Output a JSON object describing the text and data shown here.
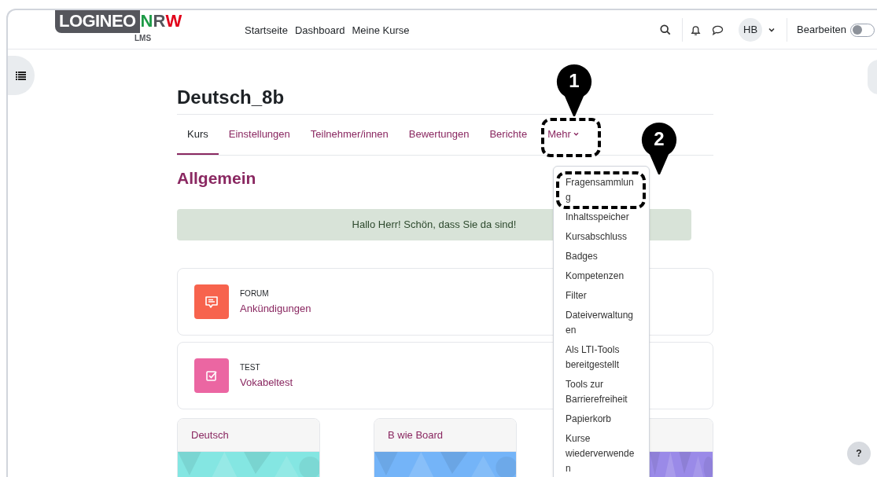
{
  "header": {
    "logo": {
      "word": "LOGINEO",
      "letters": [
        {
          "text": "N",
          "color": "#1d9a46"
        },
        {
          "text": "R",
          "color": "#55565c"
        },
        {
          "text": "W",
          "color": "#e1001a"
        }
      ],
      "subtitle": "LMS"
    },
    "nav": [
      "Startseite",
      "Dashboard",
      "Meine Kurse"
    ],
    "avatar": "HB",
    "edit_toggle": {
      "label": "Bearbeiten",
      "on": false
    }
  },
  "course": {
    "title": "Deutsch_8b",
    "tabs": [
      {
        "label": "Kurs",
        "selected": true,
        "kind": "link"
      },
      {
        "label": "Einstellungen",
        "selected": false,
        "kind": "link"
      },
      {
        "label": "Teilnehmer/innen",
        "selected": false,
        "kind": "link"
      },
      {
        "label": "Bewertungen",
        "selected": false,
        "kind": "link"
      },
      {
        "label": "Berichte",
        "selected": false,
        "kind": "link"
      },
      {
        "label": "Mehr",
        "selected": false,
        "kind": "dropdown"
      }
    ]
  },
  "more_menu": {
    "items": [
      "Fragensammlung",
      "Inhaltsspeicher",
      "Kursabschluss",
      "Badges",
      "Kompetenzen",
      "Filter",
      "Dateiverwaltungen",
      "Als LTI-Tools bereitgestellt",
      "Tools zur Barrierefreiheit",
      "Papierkorb",
      "Kurse wiederverwenden"
    ]
  },
  "section": {
    "title": "Allgemein",
    "notice": "Hallo Herr! Schön, dass Sie da sind!",
    "activities": [
      {
        "kind": "forum",
        "type_label": "FORUM",
        "title": "Ankündigungen",
        "color": "#f7634d"
      },
      {
        "kind": "quiz",
        "type_label": "TEST",
        "title": "Vokabeltest",
        "color": "#eb66a2"
      }
    ]
  },
  "course_cards": [
    {
      "title": "Deutsch",
      "color": "#84e6e2"
    },
    {
      "title": "B wie Board",
      "color": "#74b4f8"
    },
    {
      "color": "#9a8ae8"
    }
  ],
  "annotations": [
    {
      "label": "1"
    },
    {
      "label": "2"
    }
  ],
  "help_button": "?"
}
